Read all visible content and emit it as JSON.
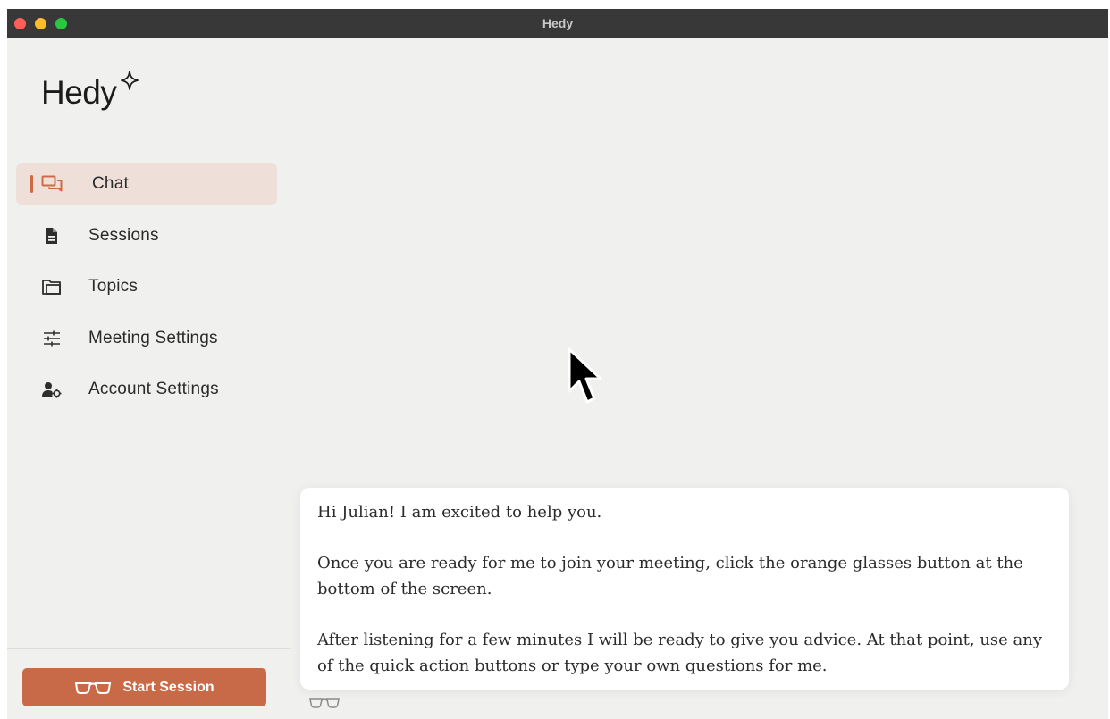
{
  "window": {
    "title": "Hedy"
  },
  "sidebar": {
    "logo": "Hedy",
    "items": [
      {
        "label": "Chat",
        "icon": "chat-bubbles-icon",
        "active": true
      },
      {
        "label": "Sessions",
        "icon": "document-icon",
        "active": false
      },
      {
        "label": "Topics",
        "icon": "folder-icon",
        "active": false
      },
      {
        "label": "Meeting Settings",
        "icon": "sliders-icon",
        "active": false
      },
      {
        "label": "Account Settings",
        "icon": "user-gear-icon",
        "active": false
      }
    ],
    "start_session": {
      "label": "Start Session",
      "icon": "glasses-icon"
    }
  },
  "chat": {
    "messages": [
      "Hi Julian! I am excited to help you.",
      "Once you are ready for me to join your meeting, click the orange glasses button at the bottom of the screen.",
      "After listening for a few minutes I will be ready to give you advice. At that point, use any of the quick action buttons or type your own questions for me."
    ]
  },
  "colors": {
    "accent": "#c86a48",
    "active_bg": "#f3e2da",
    "titlebar": "#383838"
  }
}
